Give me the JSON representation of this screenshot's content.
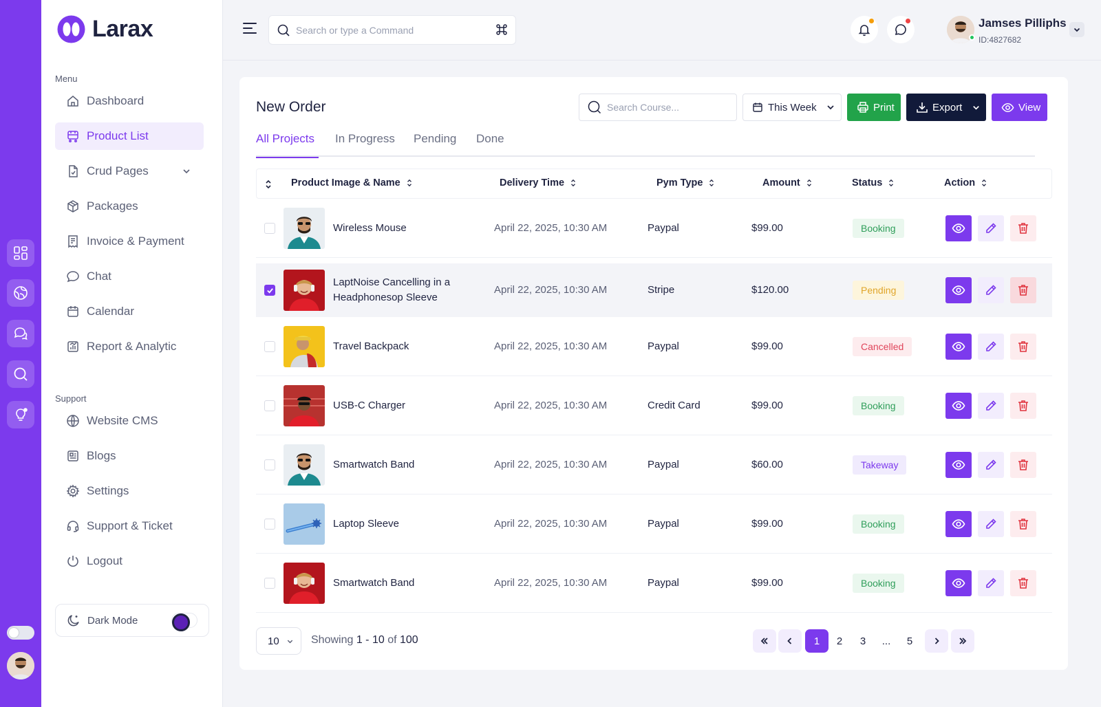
{
  "brand": {
    "name": "Larax",
    "accent": "#7c3aed"
  },
  "rail": {
    "icons": [
      "grid-icon",
      "globe-icon",
      "chat-icon",
      "search-icon",
      "bulb-icon"
    ]
  },
  "sidebar": {
    "menu_label": "Menu",
    "items": [
      {
        "label": "Dashboard",
        "icon": "home-icon"
      },
      {
        "label": "Product List",
        "icon": "cart-icon",
        "active": true
      },
      {
        "label": "Crud Pages",
        "icon": "file-icon",
        "has_submenu": true
      },
      {
        "label": "Packages",
        "icon": "package-icon"
      },
      {
        "label": "Invoice & Payment",
        "icon": "invoice-icon"
      },
      {
        "label": "Chat",
        "icon": "chat-icon"
      },
      {
        "label": "Calendar",
        "icon": "calendar-icon"
      },
      {
        "label": "Report & Analytic",
        "icon": "report-icon"
      }
    ],
    "support_label": "Support",
    "support_items": [
      {
        "label": "Website CMS",
        "icon": "globe-icon"
      },
      {
        "label": "Blogs",
        "icon": "blog-icon"
      },
      {
        "label": "Settings",
        "icon": "gear-icon"
      },
      {
        "label": "Support & Ticket",
        "icon": "headset-icon"
      },
      {
        "label": "Logout",
        "icon": "power-icon"
      }
    ],
    "dark_mode_label": "Dark Mode"
  },
  "topbar": {
    "search_placeholder": "Search or type a Command",
    "user_name": "Jamses Pilliphs",
    "user_id": "ID:4827682",
    "bell_dot_color": "#f59e0b",
    "msg_dot_color": "#ef4444"
  },
  "card": {
    "title": "New Order",
    "search_placeholder": "Search Course...",
    "range_label": "This Week",
    "print_label": "Print",
    "export_label": "Export",
    "view_label": "View",
    "tabs": [
      "All Projects",
      "In Progress",
      "Pending",
      "Done"
    ],
    "columns": [
      "Product Image & Name",
      "Delivery Time",
      "Pym Type",
      "Amount",
      "Status",
      "Action"
    ],
    "rows": [
      {
        "name": "Wireless Mouse",
        "time": "April 22, 2025, 10:30 AM",
        "pay": "Paypal",
        "amount": "$99.00",
        "status": "Booking",
        "checked": false,
        "thumb": "teal"
      },
      {
        "name": "LaptNoise Cancelling in a Headphonesop Sleeve",
        "time": "April 22, 2025, 10:30 AM",
        "pay": "Stripe",
        "amount": "$120.00",
        "status": "Pending",
        "checked": true,
        "thumb": "red"
      },
      {
        "name": "Travel Backpack",
        "time": "April 22, 2025, 10:30 AM",
        "pay": "Paypal",
        "amount": "$99.00",
        "status": "Cancelled",
        "checked": false,
        "thumb": "yellow"
      },
      {
        "name": "USB-C Charger",
        "time": "April 22, 2025, 10:30 AM",
        "pay": "Credit Card",
        "amount": "$99.00",
        "status": "Booking",
        "checked": false,
        "thumb": "stadium"
      },
      {
        "name": "Smartwatch Band",
        "time": "April 22, 2025, 10:30 AM",
        "pay": "Paypal",
        "amount": "$60.00",
        "status": "Takeway",
        "checked": false,
        "thumb": "teal"
      },
      {
        "name": "Laptop Sleeve",
        "time": "April 22, 2025, 10:30 AM",
        "pay": "Paypal",
        "amount": "$99.00",
        "status": "Booking",
        "checked": false,
        "thumb": "blue"
      },
      {
        "name": "Smartwatch Band",
        "time": "April 22, 2025, 10:30 AM",
        "pay": "Paypal",
        "amount": "$99.00",
        "status": "Booking",
        "checked": false,
        "thumb": "red"
      }
    ],
    "status_colors": {
      "Booking": {
        "bg": "#eaf7ee",
        "fg": "#2f9e5a"
      },
      "Pending": {
        "bg": "#fdf5dc",
        "fg": "#e0a52a"
      },
      "Cancelled": {
        "bg": "#fdecee",
        "fg": "#e0455b"
      },
      "Takeway": {
        "bg": "#f0ebfd",
        "fg": "#7c3aed"
      }
    }
  },
  "pager": {
    "page_size": "10",
    "showing_prefix": "Showing",
    "range": "1 - 10",
    "of_word": "of",
    "total": "100",
    "pages": [
      "1",
      "2",
      "3",
      "...",
      "5"
    ],
    "current": "1"
  }
}
